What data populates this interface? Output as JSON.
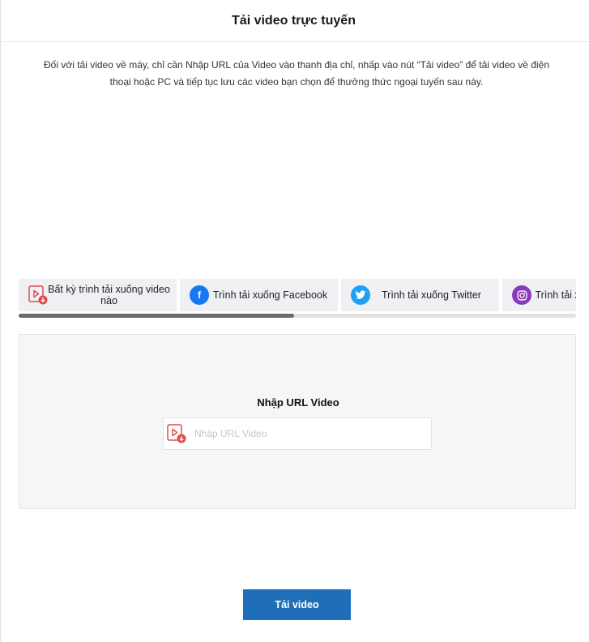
{
  "header": {
    "title": "Tải video trực tuyến"
  },
  "intro": {
    "text": "Đối với tải video về máy, chỉ cần Nhập URL của Video vào thanh địa chỉ, nhấp vào nút “Tải video” để tải video về điện thoại hoặc PC và tiếp tục lưu các video bạn chọn để thưởng thức ngoại tuyến sau này."
  },
  "tabs": [
    {
      "label": "Bất kỳ trình tải xuống video nào",
      "icon": "video-download-icon"
    },
    {
      "label": "Trình tải xuống Facebook",
      "icon": "facebook-icon"
    },
    {
      "label": "Trình tải xuống Twitter",
      "icon": "twitter-icon"
    },
    {
      "label": "Trình tải xuống Instagram",
      "icon": "instagram-icon"
    }
  ],
  "panel": {
    "title": "Nhập URL Video",
    "input_placeholder": "Nhập URL Video",
    "input_value": ""
  },
  "actions": {
    "submit_label": "Tải video"
  },
  "colors": {
    "accent": "#1f6fb8",
    "icon_red": "#e04a4a",
    "panel_bg": "#f4f6f8",
    "tab_bg": "#eef0f3"
  }
}
